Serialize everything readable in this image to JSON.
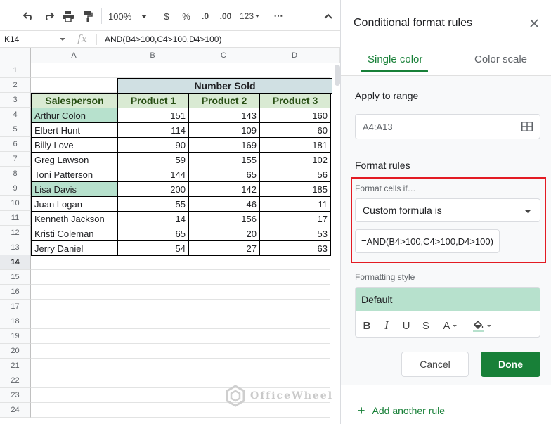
{
  "toolbar": {
    "zoom": "100%",
    "currency": "$",
    "percent": "%",
    "dec_decrease": ".0",
    "dec_increase": ".00",
    "format_more": "123",
    "more": "⋯"
  },
  "formula_bar": {
    "name_box": "K14",
    "fx": "fx",
    "formula": "AND(B4>100,C4>100,D4>100)"
  },
  "columns": [
    "A",
    "B",
    "C",
    "D"
  ],
  "rows": [
    "1",
    "2",
    "3",
    "4",
    "5",
    "6",
    "7",
    "8",
    "9",
    "10",
    "11",
    "12",
    "13",
    "14",
    "15",
    "16",
    "17",
    "18",
    "19",
    "20",
    "21",
    "22",
    "23",
    "24"
  ],
  "selected_row": "14",
  "table": {
    "group_header": "Number Sold",
    "headers": [
      "Salesperson",
      "Product 1",
      "Product 2",
      "Product 3"
    ],
    "rows": [
      {
        "name": "Arthur Colon",
        "p1": "151",
        "p2": "143",
        "p3": "160",
        "highlight": true
      },
      {
        "name": "Elbert Hunt",
        "p1": "114",
        "p2": "109",
        "p3": "60",
        "highlight": false
      },
      {
        "name": "Billy Love",
        "p1": "90",
        "p2": "169",
        "p3": "181",
        "highlight": false
      },
      {
        "name": "Greg Lawson",
        "p1": "59",
        "p2": "155",
        "p3": "102",
        "highlight": false
      },
      {
        "name": "Toni Patterson",
        "p1": "144",
        "p2": "65",
        "p3": "56",
        "highlight": false
      },
      {
        "name": "Lisa Davis",
        "p1": "200",
        "p2": "142",
        "p3": "185",
        "highlight": true
      },
      {
        "name": "Juan Logan",
        "p1": "55",
        "p2": "46",
        "p3": "11",
        "highlight": false
      },
      {
        "name": "Kenneth Jackson",
        "p1": "14",
        "p2": "156",
        "p3": "17",
        "highlight": false
      },
      {
        "name": "Kristi Coleman",
        "p1": "65",
        "p2": "20",
        "p3": "53",
        "highlight": false
      },
      {
        "name": "Jerry Daniel",
        "p1": "54",
        "p2": "27",
        "p3": "63",
        "highlight": false
      }
    ]
  },
  "watermark": "OfficeWheel",
  "panel": {
    "title": "Conditional format rules",
    "tabs": [
      "Single color",
      "Color scale"
    ],
    "active_tab": "Single color",
    "apply_label": "Apply to range",
    "range": "A4:A13",
    "format_rules_label": "Format rules",
    "format_cells_if": "Format cells if…",
    "condition": "Custom formula is",
    "formula_value": "=AND(B4>100,C4>100,D4>100)",
    "formatting_style_label": "Formatting style",
    "style_default": "Default",
    "bold": "B",
    "italic": "I",
    "underline": "U",
    "strikethrough": "S",
    "text_color": "A",
    "cancel": "Cancel",
    "done": "Done",
    "add_rule": "Add another rule"
  },
  "colors": {
    "accent": "#188038",
    "highlight": "#b7e1cd",
    "header_fill": "#d9ead3",
    "group_fill": "#d0e0e3",
    "red_box": "#e31b23"
  }
}
